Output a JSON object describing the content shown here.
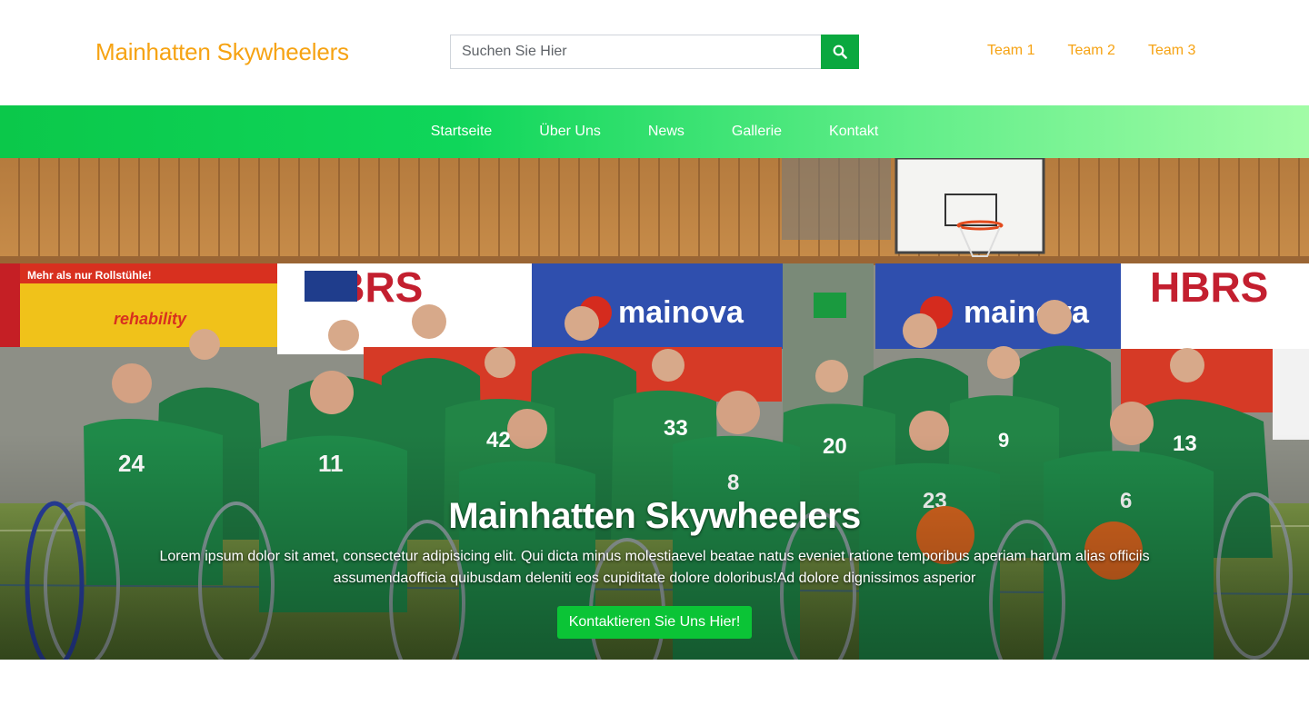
{
  "header": {
    "brand": "Mainhatten Skywheelers",
    "search_placeholder": "Suchen Sie Hier",
    "teams": [
      "Team 1",
      "Team 2",
      "Team 3"
    ]
  },
  "nav": {
    "items": [
      "Startseite",
      "Über Uns",
      "News",
      "Gallerie",
      "Kontakt"
    ]
  },
  "hero": {
    "title": "Mainhatten Skywheelers",
    "text": "Lorem ipsum dolor sit amet, consectetur adipisicing elit. Qui dicta minus molestiaevel beatae natus eveniet ratione temporibus aperiam harum alias officiis assumendaofficia quibusdam deleniti eos cupiditate dolore doloribus!Ad dolore dignissimos asperior",
    "button": "Kontaktieren Sie Uns Hier!",
    "banners": [
      "HBRS",
      "mainova",
      "HBRS",
      "Mehr als nur Rollstühle!",
      "rehability"
    ],
    "jersey_numbers": [
      "24",
      "11",
      "42",
      "33",
      "8",
      "20",
      "9",
      "13",
      "23",
      "6"
    ]
  },
  "colors": {
    "brand": "#f6a313",
    "accent": "#0aa83f",
    "button": "#0bc436"
  }
}
